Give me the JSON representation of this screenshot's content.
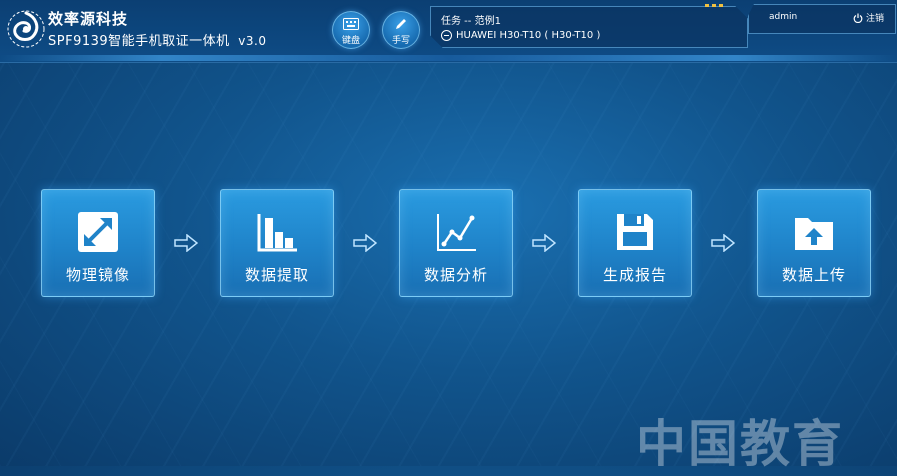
{
  "header": {
    "brand": "效率源科技",
    "app_title": "SPF9139智能手机取证一体机",
    "version": "v3.0"
  },
  "toolbar": {
    "keyboard_label": "键盘",
    "handwrite_label": "手写"
  },
  "task": {
    "title": "任务 -- 范例1",
    "device": "HUAWEI H30-T10 ( H30-T10 )"
  },
  "user": {
    "name": "admin",
    "logout_label": "注销"
  },
  "workflow": [
    {
      "label": "物理镜像",
      "icon": "expand-arrows-icon"
    },
    {
      "label": "数据提取",
      "icon": "bar-chart-icon"
    },
    {
      "label": "数据分析",
      "icon": "line-chart-icon"
    },
    {
      "label": "生成报告",
      "icon": "save-disk-icon"
    },
    {
      "label": "数据上传",
      "icon": "upload-folder-icon"
    }
  ],
  "watermark": "中国教育",
  "colors": {
    "background": "#11548c",
    "card": "#2a9be0",
    "accent": "#f0c040"
  }
}
